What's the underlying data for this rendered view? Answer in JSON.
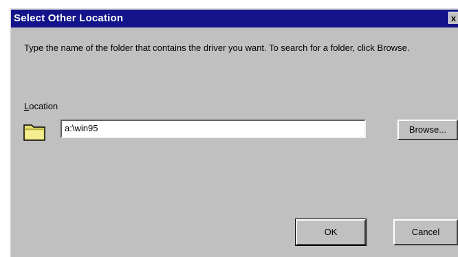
{
  "dialog": {
    "title": "Select Other Location",
    "close_glyph": "x",
    "instructions": "Type the name of the folder that contains the driver you want. To search for a folder, click Browse.",
    "location": {
      "label_mnemonic": "L",
      "label_rest": "ocation",
      "value": "a:\\win95",
      "icon": "folder-icon"
    },
    "buttons": {
      "browse": "Browse...",
      "ok": "OK",
      "cancel": "Cancel"
    }
  },
  "colors": {
    "titlebar": "#13148a",
    "face": "#c0c0c0"
  }
}
